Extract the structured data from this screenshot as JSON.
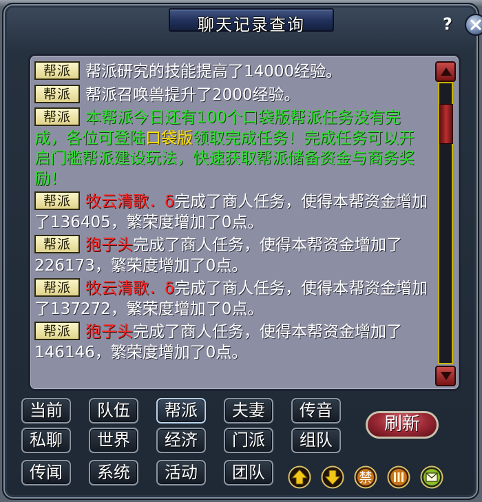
{
  "window": {
    "title": "聊天记录查询",
    "help_label": "?"
  },
  "messages": [
    {
      "tag": "帮派",
      "parts": [
        {
          "text": "帮派研究的技能提高了14000经验。",
          "style": "normal"
        }
      ]
    },
    {
      "tag": "帮派",
      "parts": [
        {
          "text": "帮派召唤兽提升了2000经验。",
          "style": "normal"
        }
      ]
    },
    {
      "tag": "帮派",
      "parts": [
        {
          "text": "本帮派今日还有100个口袋版帮派任务没有完成，各位可登陆",
          "style": "green"
        },
        {
          "text": "口袋版",
          "style": "highlight"
        },
        {
          "text": "领取完成任务！完成任务可以开启门槛帮派建设玩法，快速获取帮派储备资金与商务奖励！",
          "style": "green"
        }
      ]
    },
    {
      "tag": "帮派",
      "parts": [
        {
          "text": "牧云清歌．δ",
          "style": "name"
        },
        {
          "text": "完成了商人任务，使得本帮资金增加了136405，繁荣度增加了0点。",
          "style": "normal"
        }
      ]
    },
    {
      "tag": "帮派",
      "parts": [
        {
          "text": "狍子头",
          "style": "name"
        },
        {
          "text": "完成了商人任务，使得本帮资金增加了226173，繁荣度增加了0点。",
          "style": "normal"
        }
      ]
    },
    {
      "tag": "帮派",
      "parts": [
        {
          "text": "牧云清歌．δ",
          "style": "name"
        },
        {
          "text": "完成了商人任务，使得本帮资金增加了137272，繁荣度增加了0点。",
          "style": "normal"
        }
      ]
    },
    {
      "tag": "帮派",
      "parts": [
        {
          "text": "狍子头",
          "style": "name"
        },
        {
          "text": "完成了商人任务，使得本帮资金增加了146146，繁荣度增加了0点。",
          "style": "normal"
        }
      ]
    }
  ],
  "channels": {
    "active": "帮派",
    "rows": [
      [
        "当前",
        "队伍",
        "帮派",
        "夫妻",
        "传音"
      ],
      [
        "私聊",
        "世界",
        "经济",
        "门派",
        "组队"
      ],
      [
        "传闻",
        "系统",
        "活动",
        "团队"
      ]
    ]
  },
  "refresh_label": "刷新",
  "toolbar": {
    "ban_label": "禁"
  },
  "colors": {
    "system_text": "#ffffff",
    "notice_green": "#2fe02f",
    "player_name": "#ff2626",
    "highlight": "#ffe400",
    "chat_bg": "#8c8fa3"
  }
}
